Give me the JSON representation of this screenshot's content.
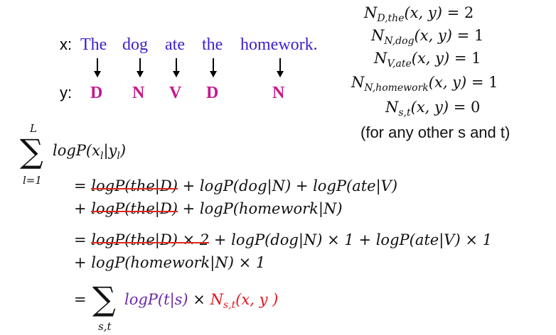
{
  "sentence": {
    "x_label": "x:",
    "y_label": "y:",
    "words": [
      "The",
      "dog",
      "ate",
      "the",
      "homework."
    ],
    "tags": [
      "D",
      "N",
      "V",
      "D",
      "N"
    ]
  },
  "counts": [
    {
      "sub": "D,the",
      "args": "(x, y)",
      "rhs": " = 2"
    },
    {
      "sub": "N,dog",
      "args": "(x, y)",
      "rhs": " = 1"
    },
    {
      "sub": "V,ate",
      "args": "(x, y)",
      "rhs": " = 1"
    },
    {
      "sub": "N,homework",
      "args": "(x, y)",
      "rhs": " = 1"
    },
    {
      "sub": "s,t",
      "args": "(x, y)",
      "rhs": " = 0"
    }
  ],
  "note": "(for any other s and t)",
  "sum1": {
    "upper": "L",
    "sigma": "∑",
    "lower": "l=1",
    "term_main": "logP(x",
    "term_sub_x": "l",
    "term_bar": "|y",
    "term_sub_y": "l",
    "term_close": ")"
  },
  "lines": {
    "l1": {
      "prefix": "= ",
      "struck": "logP(the|D)",
      "rest": " + logP(dog|N) + logP(ate|V)"
    },
    "l2": {
      "prefix": "+ ",
      "struck": "logP(the|D)",
      "rest": " + logP(homework|N)"
    },
    "l3": {
      "prefix": "= ",
      "struck": "logP(the|D) × 2",
      "rest": " + logP(dog|N) × 1 + logP(ate|V) × 1"
    },
    "l4": {
      "text": "+ logP(homework|N) × 1"
    }
  },
  "final": {
    "eq": "=",
    "sigma": "∑",
    "lower": "s,t",
    "term_purple": "logP(t|s)",
    "times": " × ",
    "count_sub": "s,t",
    "count_args": "(x, y )"
  }
}
